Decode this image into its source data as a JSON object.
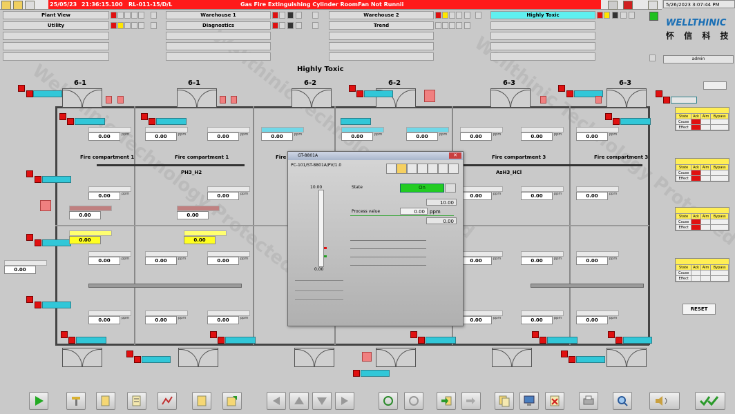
{
  "topbar": {
    "date": "25/05/23",
    "time": "21:36:15.100",
    "tag": "RL-011-15/D/L",
    "alarm": "Gas Fire Extinguishing Cylinder RoomFan Not Runnii"
  },
  "datetime": "5/26/2023 3:07:44 PM",
  "nav": {
    "plant_view": "Plant View",
    "warehouse1": "Warehouse 1",
    "warehouse2": "Warehouse 2",
    "highly_toxic": "Highly Toxic",
    "utility": "Utility",
    "diagnostics": "Diagnostics",
    "trend": "Trend"
  },
  "logo": {
    "en": "WELLTHINIC",
    "cn": "怀 信 科 技"
  },
  "login_label": "admin",
  "main": {
    "title": "Highly Toxic",
    "doors": [
      "6-1",
      "6-1",
      "6-2",
      "6-2",
      "6-3",
      "6-3"
    ],
    "compartments": [
      "Fire compartment 1",
      "Fire compartment 1",
      "Fire compartment 2",
      "Fire compartment 3",
      "Fire compartment 3"
    ],
    "area_labels": [
      "PH3_H2",
      "AsH3_HCl"
    ],
    "value": "0.00",
    "value_yellow": "0.00"
  },
  "dialog": {
    "title": "GT-8801A",
    "path": "PC-101/ST-8801A/PV/1.0",
    "state_label": "State",
    "state_value": "On",
    "val_top": "10.00",
    "pv_label": "Process value",
    "pv_value": "0.00",
    "pv_unit": "ppm",
    "val_bottom": "0.00",
    "scale_top": "10.00",
    "scale_bottom": "0.00"
  },
  "rpanel": {
    "cols": [
      "State",
      "Ack",
      "Alm",
      "Bypass"
    ],
    "rows": [
      "Cause",
      "Effect"
    ]
  },
  "reset_label": "RESET",
  "colors": {
    "alarm": "#ff1a1a",
    "active_tab": "#5ff0f0",
    "tag": "#31c7d8",
    "accent_green": "#20c020"
  }
}
